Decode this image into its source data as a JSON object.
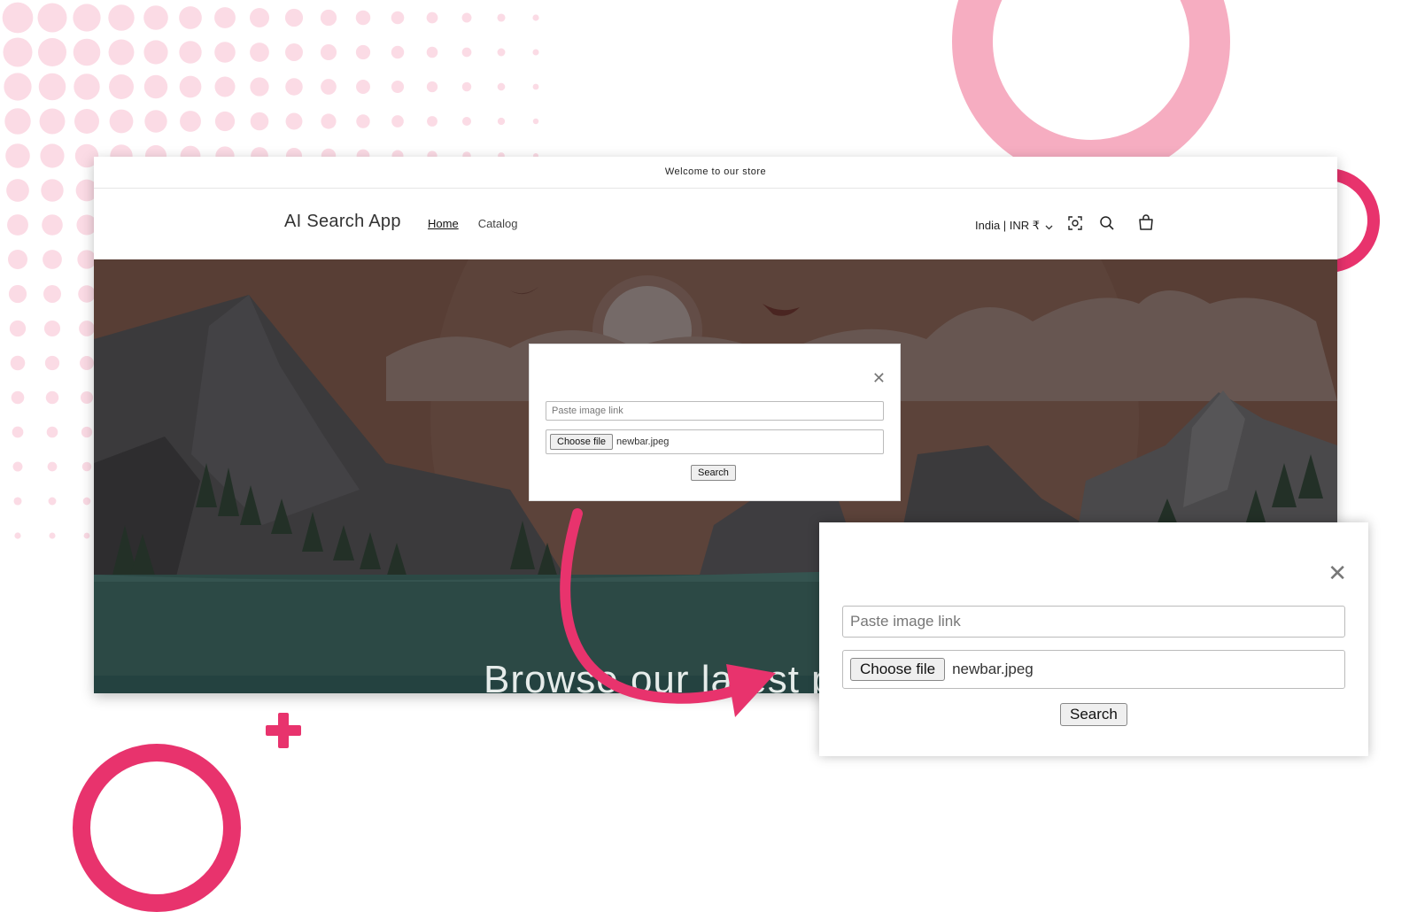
{
  "store": {
    "announcement": "Welcome to our store",
    "brand": "AI Search App",
    "nav": [
      {
        "label": "Home",
        "active": true
      },
      {
        "label": "Catalog",
        "active": false
      }
    ],
    "country_selector": "India | INR ₹",
    "hero_heading": "Browse our latest p"
  },
  "icons": [
    "image-search-icon",
    "search-icon",
    "cart-icon",
    "chevron-down-icon",
    "close-icon"
  ],
  "modal_small": {
    "close_symbol": "✕",
    "link_placeholder": "Paste image link",
    "choose_file_label": "Choose file",
    "file_name": "newbar.jpeg",
    "search_label": "Search"
  },
  "modal_large": {
    "close_symbol": "✕",
    "link_placeholder": "Paste image link",
    "choose_file_label": "Choose file",
    "file_name": "newbar.jpeg",
    "search_label": "Search"
  },
  "colors": {
    "accent": "#e8336d",
    "ring_pink": "#f6adc1",
    "hero_background": "#583e35",
    "water": "#2c4945"
  }
}
